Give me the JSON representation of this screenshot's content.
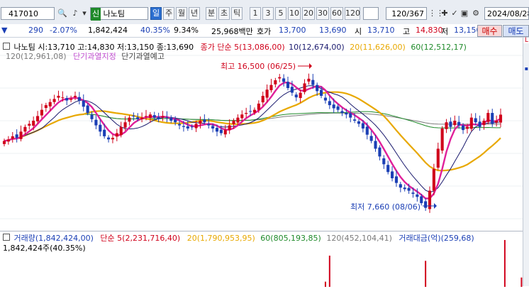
{
  "toolbar": {
    "code": "417010",
    "name_badge": "신",
    "name": "나노팀",
    "periods": [
      "일",
      "주",
      "월",
      "년",
      "분",
      "초",
      "틱"
    ],
    "intervals": [
      "1",
      "3",
      "5",
      "10",
      "20",
      "30",
      "60",
      "120"
    ],
    "count": "120/367",
    "date": "2024/08/28"
  },
  "quote": {
    "change": "290",
    "change_pct": "-2.07%",
    "volume": "1,842,424",
    "volume_ratio": "40.35%",
    "turnover": "9.34%",
    "amount": "25,968백만",
    "ask_label": "호가",
    "ask": "13,700",
    "bid": "13,690",
    "open_label": "시",
    "open": "13,710",
    "high_label": "고",
    "high": "14,830",
    "low_label": "저",
    "low": "13,150",
    "buy_label": "매수",
    "sell_label": "매도"
  },
  "legend_top": {
    "title": "나노팀 시:13,710 고:14,830 저:13,150 종:13,690",
    "ma_close": "종가 단순 5(13,086,00)",
    "ma10": "10(12,674,00)",
    "ma20": "20(11,626,00)",
    "ma60": "60(12,512,17)",
    "ma120": "120(12,961,08)",
    "signal1": "단기과열지정",
    "signal2": "단기과열예고"
  },
  "annotations": {
    "high": "최고 16,500 (06/25)",
    "low": "최저 7,660 (08/06)"
  },
  "legend_bottom": {
    "title": "거래량(1,842,424,00)",
    "ma5": "단순 5(2,231,716,40)",
    "ma20": "20(1,790,953,95)",
    "ma60": "60(805,193,85)",
    "ma120": "120(452,104,41)",
    "amount": "거래대금(억)(259,68)",
    "current": "1,842,424주(40.35%)"
  },
  "colors": {
    "up": "#d0021b",
    "down": "#1b3fb5",
    "ma5": "#e0209a",
    "ma10": "#1a1a6e",
    "ma20": "#e8a800",
    "ma60": "#1f8a2a",
    "ma120": "#7a7a7a"
  },
  "chart_data": {
    "type": "candlestick",
    "x_range": [
      "2024-03",
      "2024-08-28"
    ],
    "y_range": [
      7000,
      17500
    ],
    "high_point": {
      "value": 16500,
      "date": "06/25"
    },
    "low_point": {
      "value": 7660,
      "date": "08/06"
    },
    "latest": {
      "open": 13710,
      "high": 14830,
      "low": 13150,
      "close": 13690
    },
    "close": [
      12000,
      12100,
      12300,
      12200,
      12600,
      12900,
      13100,
      13300,
      13600,
      14000,
      14300,
      14500,
      14700,
      14900,
      14800,
      14600,
      14700,
      14900,
      14600,
      14200,
      13800,
      13400,
      13000,
      12600,
      12300,
      12100,
      12200,
      12500,
      12900,
      13200,
      13500,
      13600,
      13400,
      13500,
      13600,
      13700,
      13500,
      13400,
      13600,
      13500,
      13300,
      13200,
      13000,
      12900,
      12800,
      12900,
      13100,
      13300,
      13200,
      13000,
      12800,
      12600,
      12500,
      12700,
      13000,
      13300,
      13500,
      13700,
      13800,
      13900,
      14000,
      14400,
      14900,
      15300,
      15600,
      15900,
      16100,
      15800,
      15400,
      15100,
      14800,
      15100,
      15700,
      16000,
      15600,
      15200,
      14900,
      14600,
      14300,
      14100,
      14000,
      13800,
      13700,
      13500,
      13300,
      13100,
      12800,
      12400,
      12000,
      11500,
      11000,
      10500,
      10000,
      9600,
      9300,
      9000,
      8900,
      8800,
      8600,
      8400,
      8000,
      7700,
      8800,
      10200,
      11500,
      12800,
      13200,
      12900,
      13300,
      13000,
      12700,
      12900,
      13500,
      13200,
      12900,
      13300,
      13800,
      13100,
      13300,
      13690
    ],
    "volume": [
      0,
      0,
      0,
      0,
      0,
      0,
      0,
      0,
      0,
      0,
      0,
      0,
      0,
      0,
      0,
      0,
      0,
      0,
      0,
      0,
      0,
      0,
      0,
      0,
      0,
      0,
      0,
      0,
      0,
      0,
      0,
      0,
      0,
      0,
      0,
      0,
      0,
      0,
      0,
      0,
      0,
      0,
      0,
      0,
      0,
      0,
      0,
      0,
      0,
      0,
      0,
      0,
      0,
      0,
      0,
      0,
      0,
      0,
      0,
      0,
      0,
      0,
      0,
      0,
      0,
      0,
      0,
      0,
      0,
      0,
      0,
      0,
      0,
      0,
      0,
      0,
      0,
      1,
      6,
      0,
      0,
      0,
      0,
      0,
      0,
      0,
      0,
      0,
      0,
      0,
      0,
      0,
      0,
      0,
      0,
      0,
      0,
      0,
      0,
      0,
      0,
      5,
      0,
      0,
      0,
      0,
      0,
      0,
      0,
      0,
      0,
      0,
      0,
      0,
      0,
      0,
      0,
      0,
      0,
      0,
      9,
      0,
      0,
      0,
      1.8
    ],
    "volume_unit": "millions"
  }
}
